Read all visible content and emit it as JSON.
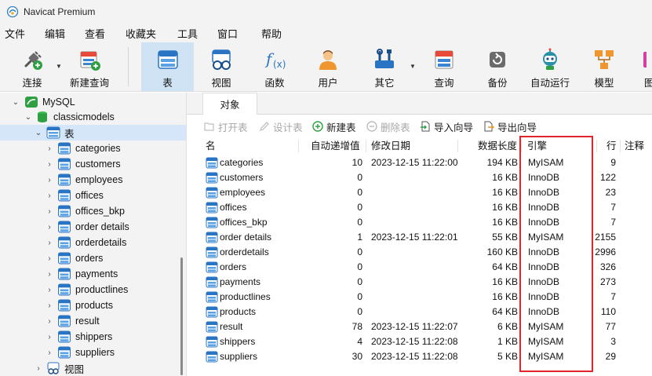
{
  "window": {
    "title": "Navicat Premium"
  },
  "menu": [
    "文件",
    "编辑",
    "查看",
    "收藏夹",
    "工具",
    "窗口",
    "帮助"
  ],
  "toolbar": {
    "connect": "连接",
    "new_query": "新建查询",
    "table": "表",
    "view": "视图",
    "function": "函数",
    "user": "用户",
    "others": "其它",
    "query": "查询",
    "backup": "备份",
    "automation": "自动运行",
    "model": "模型",
    "chart": "图"
  },
  "tree": {
    "connection": "MySQL",
    "database": "classicmodels",
    "tables_group": "表",
    "tables": [
      "categories",
      "customers",
      "employees",
      "offices",
      "offices_bkp",
      "order details",
      "orderdetails",
      "orders",
      "payments",
      "productlines",
      "products",
      "result",
      "shippers",
      "suppliers"
    ],
    "views_group": "视图"
  },
  "tab": {
    "objects": "对象"
  },
  "object_toolbar": {
    "open_table": "打开表",
    "design_table": "设计表",
    "new_table": "新建表",
    "delete_table": "删除表",
    "import_wizard": "导入向导",
    "export_wizard": "导出向导"
  },
  "columns": {
    "name": "名",
    "auto_increment": "自动递增值",
    "modified": "修改日期",
    "data_length": "数据长度",
    "engine": "引擎",
    "rows": "行",
    "comment": "注释"
  },
  "rows": [
    {
      "name": "categories",
      "auto_inc": "10",
      "modified": "2023-12-15 11:22:00",
      "size": "194 KB",
      "engine": "MyISAM",
      "rows": "9"
    },
    {
      "name": "customers",
      "auto_inc": "0",
      "modified": "",
      "size": "16 KB",
      "engine": "InnoDB",
      "rows": "122"
    },
    {
      "name": "employees",
      "auto_inc": "0",
      "modified": "",
      "size": "16 KB",
      "engine": "InnoDB",
      "rows": "23"
    },
    {
      "name": "offices",
      "auto_inc": "0",
      "modified": "",
      "size": "16 KB",
      "engine": "InnoDB",
      "rows": "7"
    },
    {
      "name": "offices_bkp",
      "auto_inc": "0",
      "modified": "",
      "size": "16 KB",
      "engine": "InnoDB",
      "rows": "7"
    },
    {
      "name": "order details",
      "auto_inc": "1",
      "modified": "2023-12-15 11:22:01",
      "size": "55 KB",
      "engine": "MyISAM",
      "rows": "2155"
    },
    {
      "name": "orderdetails",
      "auto_inc": "0",
      "modified": "",
      "size": "160 KB",
      "engine": "InnoDB",
      "rows": "2996"
    },
    {
      "name": "orders",
      "auto_inc": "0",
      "modified": "",
      "size": "64 KB",
      "engine": "InnoDB",
      "rows": "326"
    },
    {
      "name": "payments",
      "auto_inc": "0",
      "modified": "",
      "size": "16 KB",
      "engine": "InnoDB",
      "rows": "273"
    },
    {
      "name": "productlines",
      "auto_inc": "0",
      "modified": "",
      "size": "16 KB",
      "engine": "InnoDB",
      "rows": "7"
    },
    {
      "name": "products",
      "auto_inc": "0",
      "modified": "",
      "size": "64 KB",
      "engine": "InnoDB",
      "rows": "110"
    },
    {
      "name": "result",
      "auto_inc": "78",
      "modified": "2023-12-15 11:22:07",
      "size": "6 KB",
      "engine": "MyISAM",
      "rows": "77"
    },
    {
      "name": "shippers",
      "auto_inc": "4",
      "modified": "2023-12-15 11:22:08",
      "size": "1 KB",
      "engine": "MyISAM",
      "rows": "3"
    },
    {
      "name": "suppliers",
      "auto_inc": "30",
      "modified": "2023-12-15 11:22:08",
      "size": "5 KB",
      "engine": "MyISAM",
      "rows": "29"
    }
  ],
  "colors": {
    "accent": "#1e73c8",
    "selected": "#cfe3f5",
    "highlight_box": "#e0262c"
  }
}
